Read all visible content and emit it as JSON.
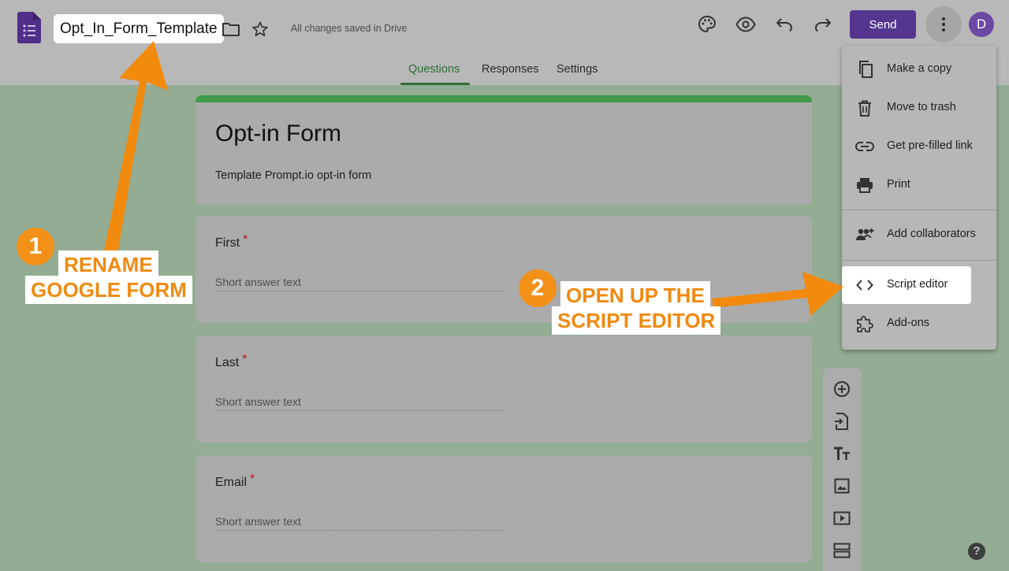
{
  "header": {
    "form_name": "Opt_In_Form_Template",
    "save_status": "All changes saved in Drive",
    "send_label": "Send",
    "avatar_initial": "D",
    "icons": [
      "forms-logo-icon",
      "folder-icon",
      "star-icon",
      "palette-icon",
      "preview-eye-icon",
      "undo-icon",
      "redo-icon",
      "more-vert-icon"
    ]
  },
  "tabs": [
    {
      "label": "Questions",
      "active": true
    },
    {
      "label": "Responses",
      "active": false
    },
    {
      "label": "Settings",
      "active": false
    }
  ],
  "form": {
    "title": "Opt-in Form",
    "description": "Template Prompt.io opt-in form",
    "questions": [
      {
        "label": "First",
        "required_mark": "*",
        "placeholder": "Short answer text"
      },
      {
        "label": "Last",
        "required_mark": "*",
        "placeholder": "Short answer text"
      },
      {
        "label": "Email",
        "required_mark": "*",
        "placeholder": "Short answer text"
      }
    ]
  },
  "menu": {
    "items": [
      {
        "label": "Make a copy",
        "icon": "copy-icon"
      },
      {
        "label": "Move to trash",
        "icon": "trash-icon"
      },
      {
        "label": "Get pre-filled link",
        "icon": "link-icon"
      },
      {
        "label": "Print",
        "icon": "print-icon"
      },
      {
        "label": "Add collaborators",
        "icon": "add-people-icon"
      },
      {
        "label": "Script editor",
        "icon": "code-icon",
        "highlighted": true
      },
      {
        "label": "Add-ons",
        "icon": "puzzle-icon"
      }
    ]
  },
  "side_toolbar": {
    "tools": [
      "add-question-icon",
      "import-questions-icon",
      "title-text-icon",
      "image-icon",
      "video-icon",
      "section-icon"
    ]
  },
  "help_label": "?",
  "annotations": {
    "step1": {
      "number": "1",
      "line1": "RENAME",
      "line2": "GOOGLE FORM"
    },
    "step2": {
      "number": "2",
      "line1": "OPEN UP THE",
      "line2": "SCRIPT EDITOR"
    }
  },
  "colors": {
    "accent_purple": "#55368f",
    "form_green": "#3f9a4c",
    "annotation_orange": "#f29018",
    "required_red": "#b21616"
  }
}
